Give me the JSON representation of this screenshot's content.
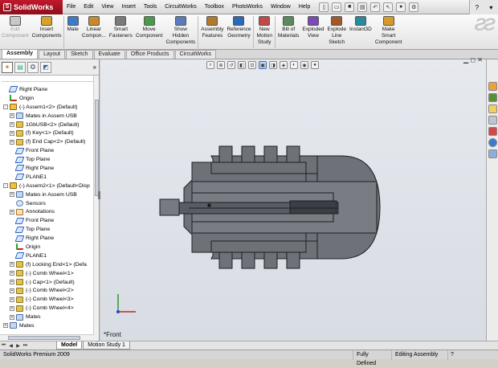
{
  "app": {
    "logo_text": "SolidWorks"
  },
  "menu": [
    "File",
    "Edit",
    "View",
    "Insert",
    "Tools",
    "CircuitWorks",
    "Toolbox",
    "PhotoWorks",
    "Window",
    "Help"
  ],
  "commands": [
    {
      "label": "Edit\nComponent",
      "disabled": true
    },
    {
      "label": "Insert\nComponents"
    },
    {
      "label": "Mate"
    },
    {
      "label": "Linear\nCompon..."
    },
    {
      "label": "Smart\nFasteners"
    },
    {
      "label": "Move\nComponent"
    },
    {
      "label": "Show\nHidden\nComponents"
    },
    {
      "label": "Assembly\nFeatures"
    },
    {
      "label": "Reference\nGeometry"
    },
    {
      "label": "New\nMotion\nStudy"
    },
    {
      "label": "Bill of\nMaterials"
    },
    {
      "label": "Exploded\nView"
    },
    {
      "label": "Explode\nLine\nSketch"
    },
    {
      "label": "Instant3D"
    },
    {
      "label": "Make\nSmart\nComponent"
    }
  ],
  "tabs": [
    "Assembly",
    "Layout",
    "Sketch",
    "Evaluate",
    "Office Products",
    "CircuitWorks"
  ],
  "tree": [
    {
      "label": "Right Plane",
      "icon": "plane",
      "indent": 0,
      "exp": ""
    },
    {
      "label": "Origin",
      "icon": "origin",
      "indent": 0,
      "exp": ""
    },
    {
      "label": "(-) Assem1<2> (Default)",
      "icon": "asm",
      "indent": 0,
      "exp": "-"
    },
    {
      "label": "Mates in Assem USB",
      "icon": "mate",
      "indent": 1,
      "exp": "+"
    },
    {
      "label": "1GbUSB<2> (Default)",
      "icon": "part",
      "indent": 1,
      "exp": "+"
    },
    {
      "label": "(f) Key<1> (Default)",
      "icon": "part",
      "indent": 1,
      "exp": "+"
    },
    {
      "label": "(f) End Cap<2> (Default)",
      "icon": "part",
      "indent": 1,
      "exp": "+"
    },
    {
      "label": "Front Plane",
      "icon": "plane",
      "indent": 1,
      "exp": ""
    },
    {
      "label": "Top Plane",
      "icon": "plane",
      "indent": 1,
      "exp": ""
    },
    {
      "label": "Right Plane",
      "icon": "plane",
      "indent": 1,
      "exp": ""
    },
    {
      "label": "PLANE1",
      "icon": "plane",
      "indent": 1,
      "exp": ""
    },
    {
      "label": "(-) Assem2<1> (Default<Disp",
      "icon": "asm",
      "indent": 0,
      "exp": "-"
    },
    {
      "label": "Mates in Assem USB",
      "icon": "mate",
      "indent": 1,
      "exp": "+"
    },
    {
      "label": "Sensors",
      "icon": "sensor",
      "indent": 1,
      "exp": ""
    },
    {
      "label": "Annotations",
      "icon": "annot",
      "indent": 1,
      "exp": "+"
    },
    {
      "label": "Front Plane",
      "icon": "plane",
      "indent": 1,
      "exp": ""
    },
    {
      "label": "Top Plane",
      "icon": "plane",
      "indent": 1,
      "exp": ""
    },
    {
      "label": "Right Plane",
      "icon": "plane",
      "indent": 1,
      "exp": ""
    },
    {
      "label": "Origin",
      "icon": "origin",
      "indent": 1,
      "exp": ""
    },
    {
      "label": "PLANE1",
      "icon": "plane",
      "indent": 1,
      "exp": ""
    },
    {
      "label": "(f) Locking End<1> (Defa",
      "icon": "part",
      "indent": 1,
      "exp": "+"
    },
    {
      "label": "(-) Comb Wheel<1>",
      "icon": "part",
      "indent": 1,
      "exp": "+"
    },
    {
      "label": "(-) Cap<1> (Default)",
      "icon": "part",
      "indent": 1,
      "exp": "+"
    },
    {
      "label": "(-) Comb Wheel<2>",
      "icon": "part",
      "indent": 1,
      "exp": "+"
    },
    {
      "label": "(-) Comb Wheel<3>",
      "icon": "part",
      "indent": 1,
      "exp": "+"
    },
    {
      "label": "(-) Comb Wheel<4>",
      "icon": "part",
      "indent": 1,
      "exp": "+"
    },
    {
      "label": "Mates",
      "icon": "mate",
      "indent": 1,
      "exp": "+"
    },
    {
      "label": "Mates",
      "icon": "mate",
      "indent": 0,
      "exp": "+"
    }
  ],
  "viewport": {
    "view_label": "*Front"
  },
  "model_tabs": [
    "Model",
    "Motion Study 1"
  ],
  "status": {
    "product": "SolidWorks Premium 2009",
    "state": "Fully Defined",
    "mode": "Editing Assembly"
  },
  "colors": {
    "part_fill": "#6f7179",
    "part_stroke": "#1d1e24",
    "viewport_bg": "#dde1e7",
    "accent": "#c0192b"
  }
}
